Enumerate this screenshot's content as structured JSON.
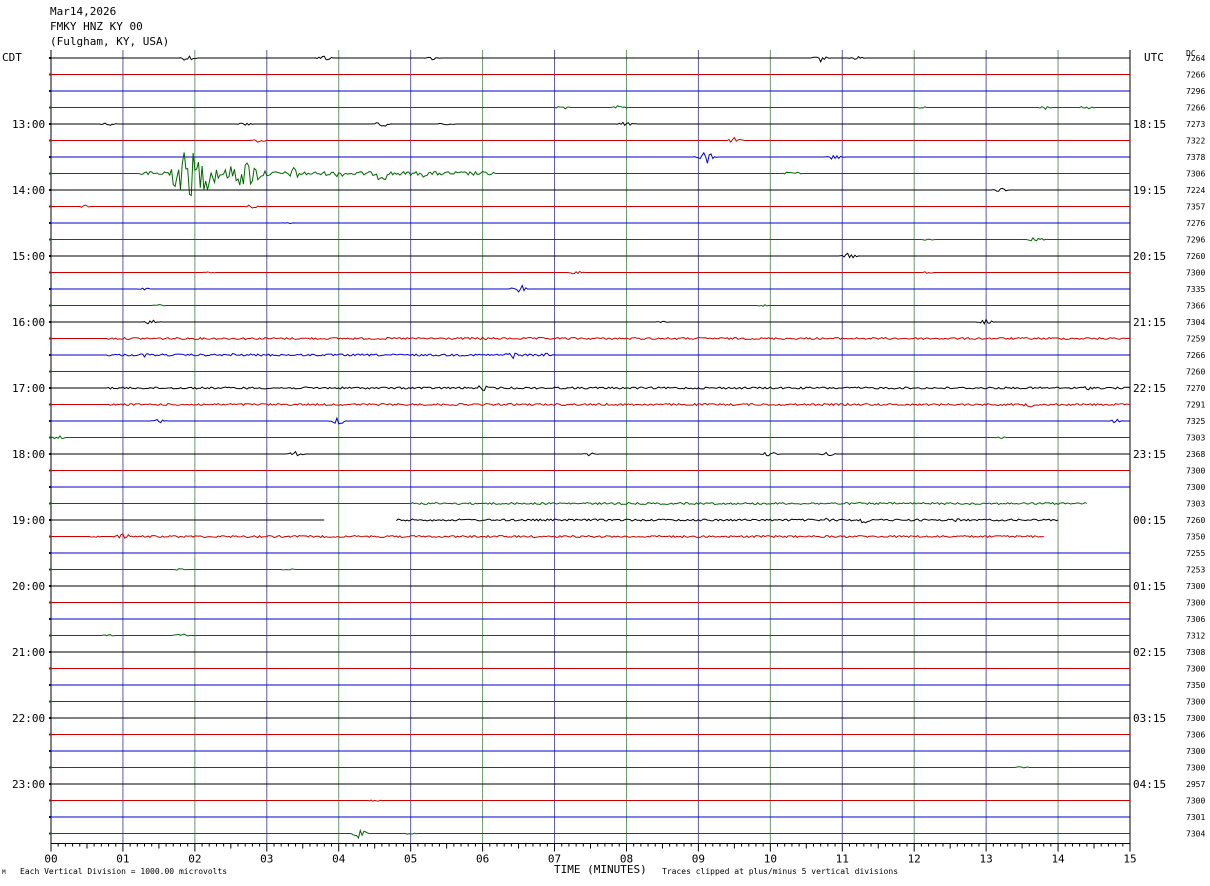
{
  "header": {
    "date": "Mar14,2026",
    "station": "FMKY HNZ KY 00",
    "location": "(Fulgham, KY, USA)"
  },
  "chart_data": {
    "type": "line",
    "title": "",
    "left_axis_label": "CDT",
    "right_axis_label": "UTC",
    "dc_label": "DC",
    "xlabel": "TIME (MINUTES)",
    "xlim": [
      0,
      15
    ],
    "x_ticks": [
      "00",
      "01",
      "02",
      "03",
      "04",
      "05",
      "06",
      "07",
      "08",
      "09",
      "10",
      "11",
      "12",
      "13",
      "14",
      "15"
    ],
    "left_hour_labels": [
      "13:00",
      "14:00",
      "15:00",
      "16:00",
      "17:00",
      "18:00",
      "19:00",
      "20:00",
      "21:00",
      "22:00",
      "23:00"
    ],
    "right_hour_labels": [
      "18:15",
      "19:15",
      "20:15",
      "21:15",
      "22:15",
      "23:15",
      "00:15",
      "01:15",
      "02:15",
      "03:15",
      "04:15"
    ],
    "first_hour_label_row": 4,
    "rows_per_hour": 4,
    "trace_colors": [
      "#000000",
      "#cc0000",
      "#0000cc",
      "#006600"
    ],
    "dc_values": [
      "7264",
      "7266",
      "7296",
      "7266",
      "7273",
      "7322",
      "7378",
      "7306",
      "7224",
      "7357",
      "7276",
      "7296",
      "7260",
      "7300",
      "7335",
      "7366",
      "7304",
      "7259",
      "7266",
      "7260",
      "7270",
      "7291",
      "7325",
      "7303",
      "2368",
      "7300",
      "7300",
      "7303",
      "7260",
      "7350",
      "7255",
      "7253",
      "7300",
      "7300",
      "7306",
      "7312",
      "7308",
      "7300",
      "7350",
      "7300",
      "7300",
      "7306",
      "7300",
      "7300",
      "2957",
      "7300",
      "7301",
      "7304"
    ],
    "events": [
      {
        "row": 0,
        "minute": 1.9,
        "amp": 3
      },
      {
        "row": 0,
        "minute": 3.8,
        "amp": 3
      },
      {
        "row": 0,
        "minute": 5.3,
        "amp": 2
      },
      {
        "row": 0,
        "minute": 10.7,
        "amp": 4
      },
      {
        "row": 0,
        "minute": 11.2,
        "amp": 2
      },
      {
        "row": 3,
        "minute": 7.1,
        "amp": 2
      },
      {
        "row": 3,
        "minute": 7.9,
        "amp": 2
      },
      {
        "row": 3,
        "minute": 12.1,
        "amp": 1
      },
      {
        "row": 3,
        "minute": 13.8,
        "amp": 2
      },
      {
        "row": 3,
        "minute": 14.4,
        "amp": 2
      },
      {
        "row": 4,
        "minute": 0.8,
        "amp": 2
      },
      {
        "row": 4,
        "minute": 2.7,
        "amp": 2
      },
      {
        "row": 4,
        "minute": 4.6,
        "amp": 3
      },
      {
        "row": 4,
        "minute": 5.5,
        "amp": 2
      },
      {
        "row": 4,
        "minute": 8.0,
        "amp": 4
      },
      {
        "row": 5,
        "minute": 2.9,
        "amp": 2
      },
      {
        "row": 5,
        "minute": 9.5,
        "amp": 3
      },
      {
        "row": 6,
        "minute": 9.1,
        "amp": 8
      },
      {
        "row": 6,
        "minute": 10.9,
        "amp": 3
      },
      {
        "row": 7,
        "minute": 1.9,
        "amp": 24
      },
      {
        "row": 7,
        "minute": 2.1,
        "amp": 18
      },
      {
        "row": 7,
        "minute": 2.7,
        "amp": 14
      },
      {
        "row": 7,
        "minute": 3.4,
        "amp": 7
      },
      {
        "row": 7,
        "minute": 4.0,
        "amp": 4
      },
      {
        "row": 7,
        "minute": 4.6,
        "amp": 9
      },
      {
        "row": 7,
        "minute": 5.2,
        "amp": 4
      },
      {
        "row": 7,
        "minute": 10.3,
        "amp": 3
      },
      {
        "row": 8,
        "minute": 13.2,
        "amp": 2
      },
      {
        "row": 9,
        "minute": 0.5,
        "amp": 2
      },
      {
        "row": 9,
        "minute": 2.8,
        "amp": 2
      },
      {
        "row": 10,
        "minute": 3.3,
        "amp": 1
      },
      {
        "row": 11,
        "minute": 13.7,
        "amp": 3
      },
      {
        "row": 11,
        "minute": 12.2,
        "amp": 1
      },
      {
        "row": 12,
        "minute": 11.1,
        "amp": 3
      },
      {
        "row": 13,
        "minute": 2.2,
        "amp": 1
      },
      {
        "row": 13,
        "minute": 7.3,
        "amp": 2
      },
      {
        "row": 13,
        "minute": 12.2,
        "amp": 1
      },
      {
        "row": 14,
        "minute": 6.5,
        "amp": 5
      },
      {
        "row": 14,
        "minute": 1.3,
        "amp": 1
      },
      {
        "row": 15,
        "minute": 1.5,
        "amp": 1
      },
      {
        "row": 15,
        "minute": 9.9,
        "amp": 1
      },
      {
        "row": 16,
        "minute": 1.4,
        "amp": 3
      },
      {
        "row": 16,
        "minute": 8.5,
        "amp": 1
      },
      {
        "row": 16,
        "minute": 13.0,
        "amp": 3
      },
      {
        "row": 17,
        "minute": 6.0,
        "amp": 2
      },
      {
        "row": 17,
        "minute": 8.5,
        "amp": 1
      },
      {
        "row": 17,
        "minute": 14.5,
        "amp": 1
      },
      {
        "row": 18,
        "minute": 1.3,
        "amp": 2
      },
      {
        "row": 18,
        "minute": 2.5,
        "amp": 2
      },
      {
        "row": 18,
        "minute": 6.4,
        "amp": 4
      },
      {
        "row": 18,
        "minute": 6.9,
        "amp": 2
      },
      {
        "row": 20,
        "minute": 5.1,
        "amp": 2
      },
      {
        "row": 20,
        "minute": 6.0,
        "amp": 3
      },
      {
        "row": 20,
        "minute": 14.4,
        "amp": 2
      },
      {
        "row": 21,
        "minute": 6.2,
        "amp": 1
      },
      {
        "row": 21,
        "minute": 13.6,
        "amp": 3
      },
      {
        "row": 22,
        "minute": 1.5,
        "amp": 2
      },
      {
        "row": 22,
        "minute": 4.0,
        "amp": 4
      },
      {
        "row": 22,
        "minute": 14.8,
        "amp": 2
      },
      {
        "row": 23,
        "minute": 0.1,
        "amp": 2
      },
      {
        "row": 23,
        "minute": 13.2,
        "amp": 1
      },
      {
        "row": 24,
        "minute": 3.4,
        "amp": 3
      },
      {
        "row": 24,
        "minute": 7.5,
        "amp": 2
      },
      {
        "row": 24,
        "minute": 10.0,
        "amp": 3
      },
      {
        "row": 24,
        "minute": 10.8,
        "amp": 2
      },
      {
        "row": 27,
        "minute": 8.0,
        "amp": 1
      },
      {
        "row": 27,
        "minute": 11.0,
        "amp": 1
      },
      {
        "row": 28,
        "minute": 6.0,
        "amp": 1
      },
      {
        "row": 28,
        "minute": 10.8,
        "amp": 2
      },
      {
        "row": 28,
        "minute": 11.3,
        "amp": 4
      },
      {
        "row": 28,
        "minute": 12.6,
        "amp": 2
      },
      {
        "row": 29,
        "minute": 1.0,
        "amp": 4
      },
      {
        "row": 29,
        "minute": 0.6,
        "amp": 1
      },
      {
        "row": 31,
        "minute": 1.8,
        "amp": 1
      },
      {
        "row": 31,
        "minute": 3.3,
        "amp": 1
      },
      {
        "row": 35,
        "minute": 0.8,
        "amp": 1
      },
      {
        "row": 35,
        "minute": 1.8,
        "amp": 2
      },
      {
        "row": 43,
        "minute": 13.5,
        "amp": 1
      },
      {
        "row": 45,
        "minute": 4.5,
        "amp": 1
      },
      {
        "row": 47,
        "minute": 4.3,
        "amp": 5
      },
      {
        "row": 47,
        "minute": 5.0,
        "amp": 1
      }
    ],
    "gaps": [
      {
        "row": 28,
        "from": 3.8,
        "to": 4.8
      },
      {
        "row": 27,
        "from": 14.4,
        "to": 15
      },
      {
        "row": 28,
        "from": 14.0,
        "to": 15
      },
      {
        "row": 29,
        "from": 13.8,
        "to": 15
      }
    ],
    "noisy_rows": [
      {
        "row": 7,
        "from": 1.2,
        "to": 6.2,
        "amp": 2
      },
      {
        "row": 17,
        "from": 0.8,
        "to": 15,
        "amp": 1
      },
      {
        "row": 18,
        "from": 0.8,
        "to": 7.0,
        "amp": 1
      },
      {
        "row": 20,
        "from": 0.8,
        "to": 15,
        "amp": 1
      },
      {
        "row": 21,
        "from": 0.8,
        "to": 15,
        "amp": 1
      },
      {
        "row": 27,
        "from": 5.0,
        "to": 14.4,
        "amp": 1
      },
      {
        "row": 28,
        "from": 4.8,
        "to": 14.0,
        "amp": 1
      },
      {
        "row": 29,
        "from": 1.0,
        "to": 13.8,
        "amp": 1
      }
    ]
  },
  "footer": {
    "scale_note": "Each Vertical Division = 1000.00 microvolts",
    "clip_note": "Traces clipped at plus/minus 5 vertical divisions",
    "corner_mark": "M"
  }
}
